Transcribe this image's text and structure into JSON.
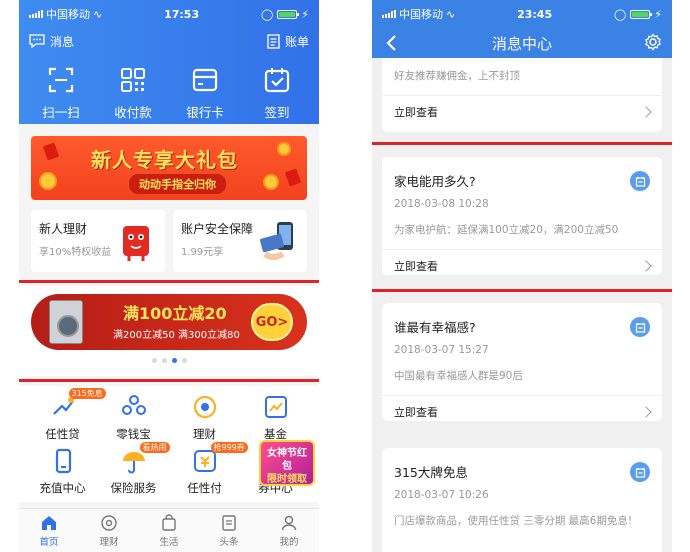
{
  "left": {
    "status": {
      "carrier": "中国移动",
      "time": "17:53"
    },
    "topbar": {
      "messages_label": "消息",
      "bill_label": "账单"
    },
    "quick_actions": [
      {
        "label": "扫一扫",
        "icon": "scan-icon"
      },
      {
        "label": "收付款",
        "icon": "qr-pay-icon"
      },
      {
        "label": "银行卡",
        "icon": "bank-card-icon"
      },
      {
        "label": "签到",
        "icon": "calendar-check-icon"
      }
    ],
    "banner": {
      "title": "新人专享大礼包",
      "subtitle": "动动手指全归你"
    },
    "cards": [
      {
        "title": "新人理财",
        "subtitle": "享10%特权收益"
      },
      {
        "title": "账户安全保障",
        "subtitle": "1.99元享"
      }
    ],
    "promo": {
      "title": "满100立减20",
      "subtitle": "满200立减50 满300立减80",
      "go_label": "GO>"
    },
    "services": [
      {
        "label": "任性贷",
        "badge": "315免息",
        "icon": "loan-icon"
      },
      {
        "label": "零钱宝",
        "badge": "",
        "icon": "coins-icon"
      },
      {
        "label": "理财",
        "badge": "",
        "icon": "finance-icon"
      },
      {
        "label": "基金",
        "badge": "",
        "icon": "chart-icon"
      },
      {
        "label": "充值中心",
        "badge": "",
        "icon": "phone-icon"
      },
      {
        "label": "保险服务",
        "badge": "看热闹",
        "icon": "umbrella-icon"
      },
      {
        "label": "任性付",
        "badge": "抢999券",
        "icon": "pay-icon"
      },
      {
        "label": "券中心",
        "badge": "",
        "icon": "coupon-icon"
      }
    ],
    "float_ad": {
      "line1": "女神节红包",
      "line2": "限时领取"
    },
    "tabs": [
      {
        "label": "首页",
        "icon": "home-icon"
      },
      {
        "label": "理财",
        "icon": "finance-tab-icon"
      },
      {
        "label": "生活",
        "icon": "bag-icon"
      },
      {
        "label": "头条",
        "icon": "news-icon"
      },
      {
        "label": "我的",
        "icon": "user-icon"
      }
    ],
    "accent_color": "#3271e8",
    "highlight_color": "#e0222a"
  },
  "right": {
    "status": {
      "carrier": "中国移动",
      "time": "23:45"
    },
    "nav_title": "消息中心",
    "messages": [
      {
        "title": "",
        "date": "",
        "body": "好友推荐赚佣金，上不封顶",
        "link": "立即查看"
      },
      {
        "title": "家电能用多久?",
        "date": "2018-03-08 10:28",
        "body": "为家电护航：延保满100立减20，满200立减50",
        "link": "立即查看"
      },
      {
        "title": "谁最有幸福感?",
        "date": "2018-03-07 15:27",
        "body": "中国最有幸福感人群是90后",
        "link": "立即查看"
      },
      {
        "title": "315大牌免息",
        "date": "2018-03-07 10:26",
        "body": "门店爆款商品，使用任性贷 三零分期 最高6期免息!",
        "link": ""
      }
    ]
  }
}
